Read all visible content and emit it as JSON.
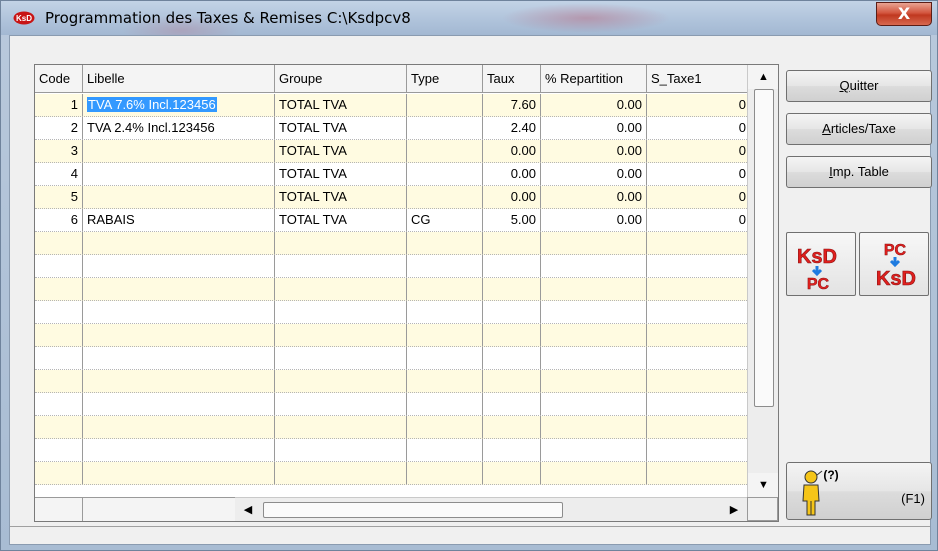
{
  "window": {
    "title": "Programmation des Taxes & Remises C:\\Ksdpcv8",
    "close_label": "X"
  },
  "grid": {
    "columns": [
      "Code",
      "Libelle",
      "Groupe",
      "Type",
      "Taux",
      "% Repartition",
      "S_Taxe1"
    ],
    "rows": [
      {
        "code": "1",
        "libelle": "TVA 7.6% Incl.123456",
        "groupe": "TOTAL TVA",
        "type": "",
        "taux": "7.60",
        "repartition": "0.00",
        "s_taxe1": "0"
      },
      {
        "code": "2",
        "libelle": "TVA 2.4% Incl.123456",
        "groupe": "TOTAL TVA",
        "type": "",
        "taux": "2.40",
        "repartition": "0.00",
        "s_taxe1": "0"
      },
      {
        "code": "3",
        "libelle": "",
        "groupe": "TOTAL TVA",
        "type": "",
        "taux": "0.00",
        "repartition": "0.00",
        "s_taxe1": "0"
      },
      {
        "code": "4",
        "libelle": "",
        "groupe": "TOTAL TVA",
        "type": "",
        "taux": "0.00",
        "repartition": "0.00",
        "s_taxe1": "0"
      },
      {
        "code": "5",
        "libelle": "",
        "groupe": "TOTAL TVA",
        "type": "",
        "taux": "0.00",
        "repartition": "0.00",
        "s_taxe1": "0"
      },
      {
        "code": "6",
        "libelle": "RABAIS",
        "groupe": "TOTAL TVA",
        "type": "CG",
        "taux": "5.00",
        "repartition": "0.00",
        "s_taxe1": "0"
      }
    ]
  },
  "buttons": {
    "quitter": {
      "accel": "Q",
      "rest": "uitter"
    },
    "articles": {
      "accel": "A",
      "rest": "rticles/Taxe"
    },
    "imp": {
      "accel": "I",
      "rest": "mp. Table"
    },
    "ksd_to_pc": {
      "top": "KsD",
      "bottom": "PC"
    },
    "pc_to_ksd": {
      "top": "PC",
      "bottom": "KsD"
    },
    "help_label": "(F1)",
    "help_mark": "(?)"
  },
  "icons": {
    "arrow_color": "#1e7be0",
    "ksd_color": "#e0201e"
  }
}
